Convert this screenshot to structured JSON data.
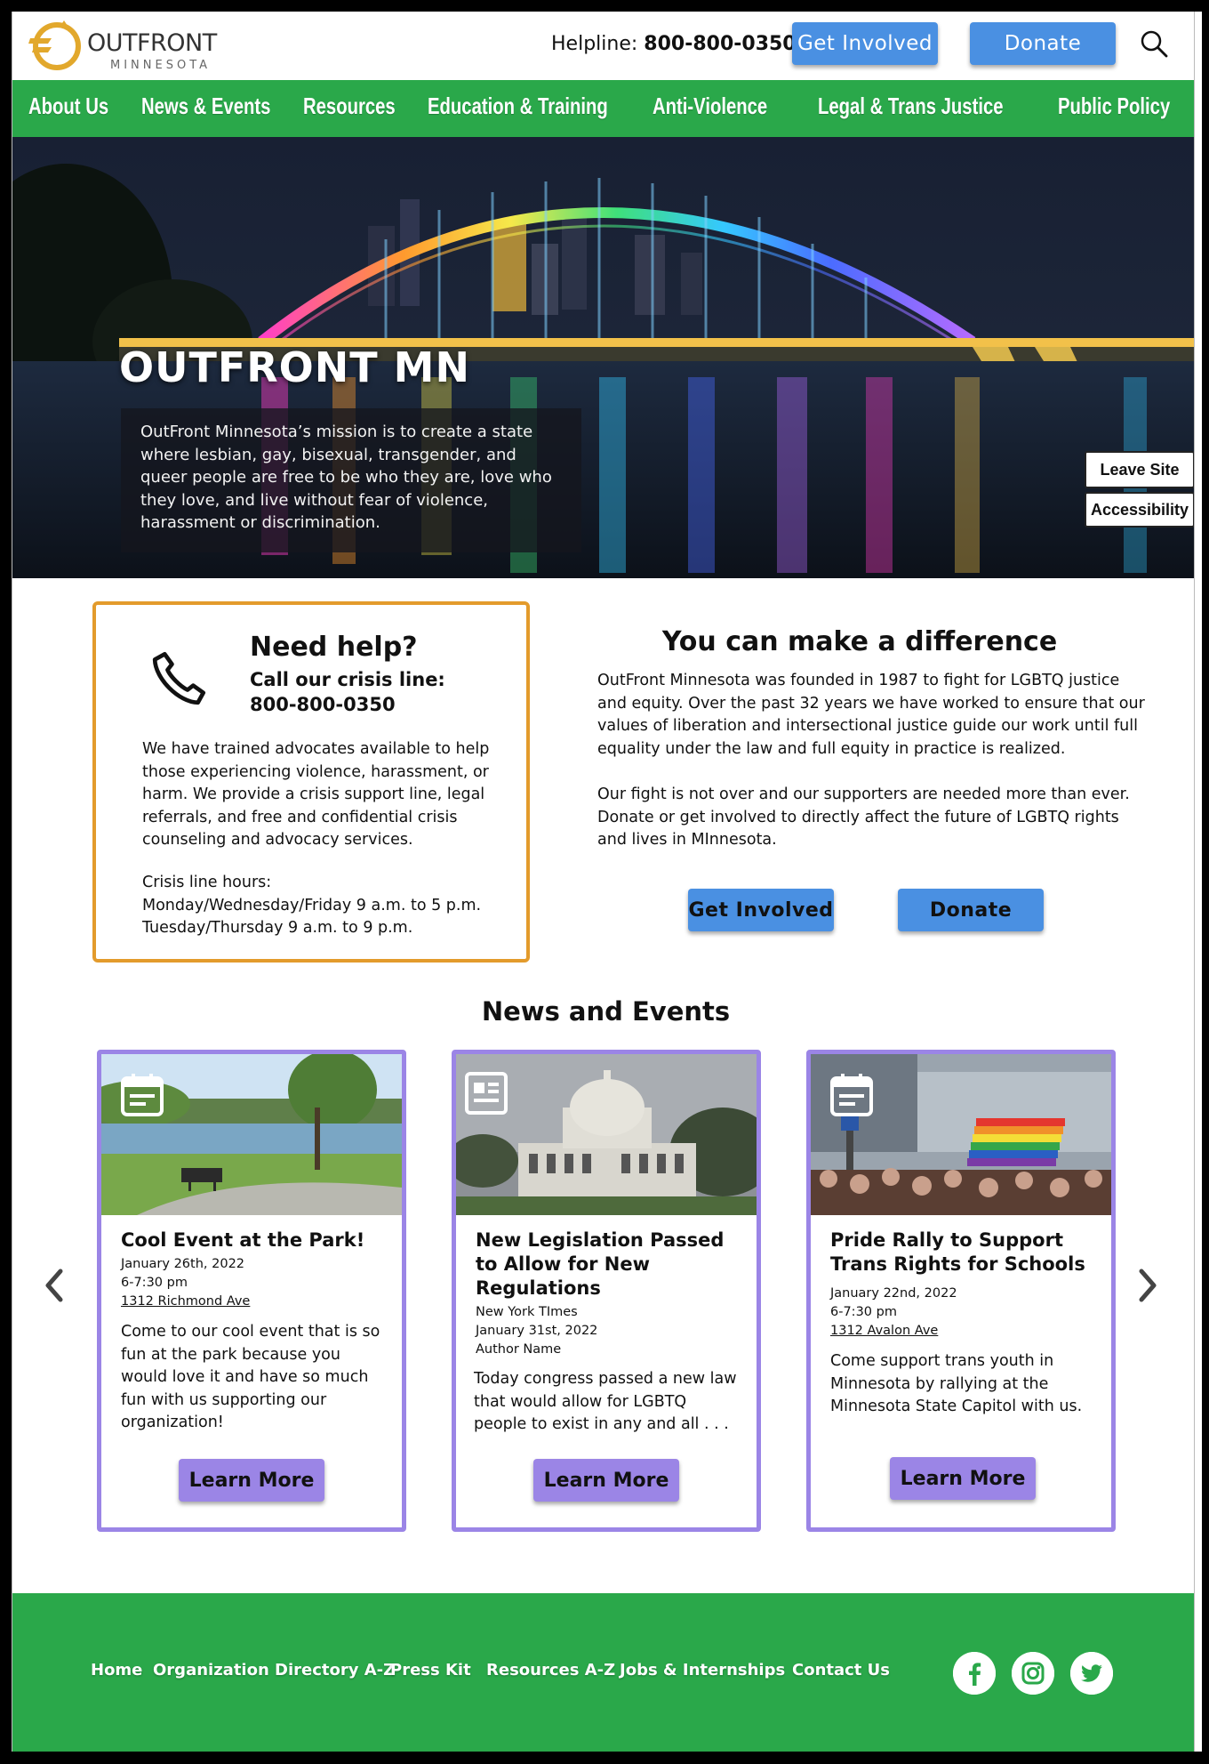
{
  "header": {
    "logo_main": "OUTFRONT",
    "logo_sub": "MINNESOTA",
    "helpline_label": "Helpline:",
    "helpline_number": "800-800-0350",
    "get_involved_label": "Get Involved",
    "donate_label": "Donate",
    "search_icon": "search-icon"
  },
  "nav": {
    "items": [
      "About Us",
      "News & Events",
      "Resources",
      "Education & Training",
      "Anti-Violence",
      "Legal & Trans Justice",
      "Public Policy"
    ]
  },
  "hero": {
    "title": "OUTFRONT MN",
    "mission": "OutFront Minnesota’s mission is to create a state where lesbian, gay, bisexual, transgender, and queer people are free to be who they are, love who they love, and live without fear of violence, harassment or discrimination.",
    "leave_site_label": "Leave Site",
    "accessibility_label": "Accessibility"
  },
  "help": {
    "title": "Need help?",
    "subtitle": "Call our  crisis line:",
    "number": "800-800-0350",
    "body": "We have trained advocates available to help those experiencing violence, harassment, or harm. We provide a crisis support line, legal referrals, and free and confidential crisis counseling and advocacy services.",
    "hours_label": "Crisis line hours:",
    "hours_1": "Monday/Wednesday/Friday 9 a.m. to 5 p.m.",
    "hours_2": "Tuesday/Thursday 9 a.m. to 9 p.m."
  },
  "difference": {
    "title": "You can make a difference",
    "p1": "OutFront Minnesota was founded in 1987 to fight for LGBTQ justice and equity. Over the past 32 years we have worked to ensure that our values of liberation and intersectional justice guide our work until full equality under the law and full equity in practice is realized.",
    "p2": "Our fight is not over and our supporters are needed more than ever. Donate or get involved to directly affect the future of LGBTQ rights and lives in MInnesota.",
    "get_involved_label": "Get Involved",
    "donate_label": "Donate"
  },
  "news": {
    "title": "News and Events",
    "cards": [
      {
        "title": "Cool Event at the Park!",
        "line1": "January 26th, 2022",
        "line2": "6-7:30 pm",
        "line3": "1312 Richmond Ave",
        "desc": "Come to our cool event that is so fun at the park because you would love it and have so much fun with us supporting our organization!",
        "button": "Learn More",
        "icon": "calendar-icon"
      },
      {
        "title": "New Legislation Passed to Allow for New Regulations",
        "line1": "New York TImes",
        "line2": "January 31st, 2022",
        "line3": "Author Name",
        "desc": "Today congress passed a new law that would allow for LGBTQ people to exist in any and all . . .",
        "button": "Learn More",
        "icon": "newspaper-icon"
      },
      {
        "title": "Pride Rally to Support Trans Rights for Schools",
        "line1": "January 22nd, 2022",
        "line2": "6-7:30 pm",
        "line3": "1312 Avalon Ave",
        "desc": "Come support trans youth in Minnesota by rallying at the Minnesota State Capitol with us.",
        "button": "Learn More",
        "icon": "calendar-icon"
      }
    ]
  },
  "footer": {
    "links": [
      "Home",
      "Organization Directory A-Z",
      "Press Kit",
      "Resources A-Z",
      "Jobs & Internships",
      "Contact Us"
    ],
    "social": [
      "facebook-icon",
      "instagram-icon",
      "twitter-icon"
    ]
  },
  "colors": {
    "nav_green": "#2aa84a",
    "button_blue": "#4a90e2",
    "help_orange": "#e39b2c",
    "card_purple": "#9b85e6"
  }
}
